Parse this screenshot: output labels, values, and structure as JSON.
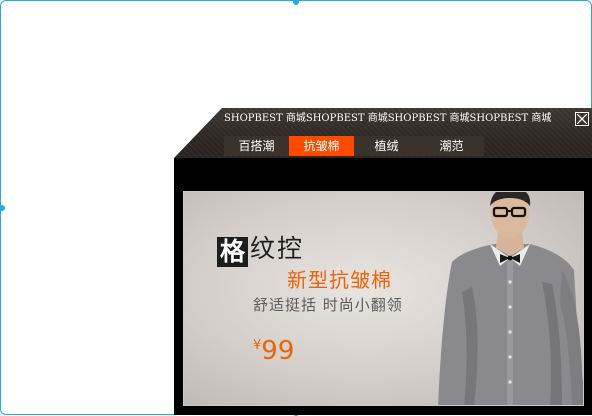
{
  "popup": {
    "marquee_text": "SHOPBEST 商城SHOPBEST 商城SHOPBEST 商城SHOPBEST 商城",
    "close_icon": "close-icon",
    "tabs": [
      {
        "label": "百搭潮",
        "active": false
      },
      {
        "label": "抗皱棉",
        "active": true
      },
      {
        "label": "植绒",
        "active": false
      },
      {
        "label": "潮范",
        "active": false
      }
    ],
    "active_tab_color": "#ff4a00",
    "header_color": "#3a332d"
  },
  "banner": {
    "ge": "格",
    "wenkong": "纹控",
    "headline": "新型抗皱棉",
    "subline": "舒适挺括 时尚小翻领",
    "currency": "¥",
    "price": "99",
    "accent_color": "#e8650c"
  },
  "selection_color": "#27a9e3"
}
